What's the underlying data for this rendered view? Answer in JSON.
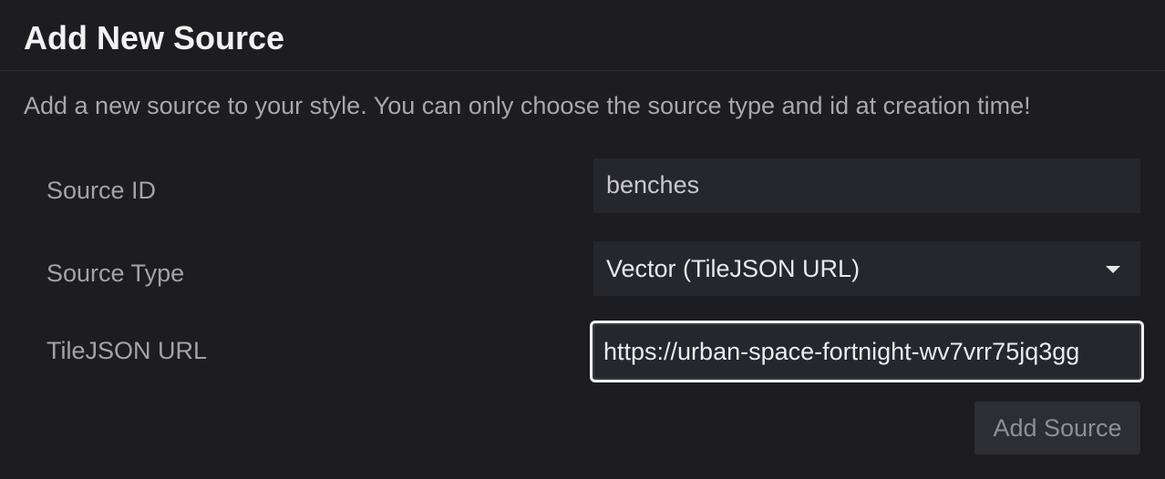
{
  "modal": {
    "title": "Add New Source",
    "description": "Add a new source to your style. You can only choose the source type and id at creation time!"
  },
  "form": {
    "source_id": {
      "label": "Source ID",
      "value": "benches"
    },
    "source_type": {
      "label": "Source Type",
      "selected": "Vector (TileJSON URL)"
    },
    "tilejson_url": {
      "label": "TileJSON URL",
      "value": "https://urban-space-fortnight-wv7vrr75jq3gg"
    },
    "submit_label": "Add Source"
  },
  "icons": {
    "select_caret": "caret-down-icon"
  },
  "colors": {
    "background": "#1c1c21",
    "input_background": "#26262d",
    "focus_border": "#f0f0f0",
    "button_background": "#2d2d34"
  }
}
